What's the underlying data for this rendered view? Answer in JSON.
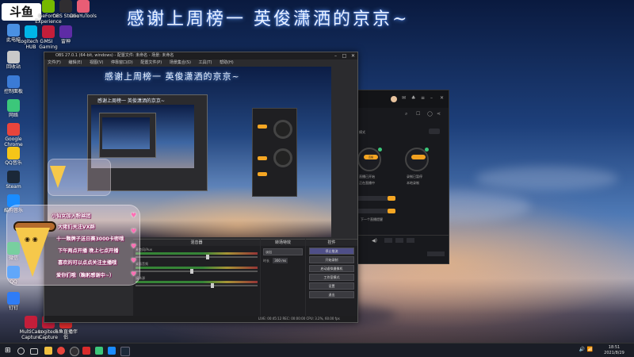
{
  "banner": {
    "text": "感谢上周榜一 英俊潇洒的京京~"
  },
  "logo": {
    "text": "斗鱼"
  },
  "desktop_icons": [
    {
      "label": "此电脑",
      "color": "#4a90e2"
    },
    {
      "label": "回收站",
      "color": "#c9c9c9"
    },
    {
      "label": "控制面板",
      "color": "#3b7bd6"
    },
    {
      "label": "网络",
      "color": "#3bc77a"
    },
    {
      "label": "Google Chrome",
      "color": "#e8453c"
    },
    {
      "label": "QQ音乐",
      "color": "#f5c518"
    },
    {
      "label": "Steam",
      "color": "#1b2838"
    },
    {
      "label": "酷狗音乐",
      "color": "#1a8cff"
    },
    {
      "label": "微信",
      "color": "#3bc77a"
    },
    {
      "label": "QQ",
      "color": "#1a8cff"
    },
    {
      "label": "钉钉",
      "color": "#2f7cf6"
    },
    {
      "label": "GeForce Experience",
      "color": "#76b900"
    },
    {
      "label": "Logitech G HUB",
      "color": "#00b4e6"
    },
    {
      "label": "MSI Gaming APP",
      "color": "#c41e3a"
    },
    {
      "label": "OBS Studio",
      "color": "#302e31"
    },
    {
      "label": "雷神",
      "color": "#5e2ca5"
    },
    {
      "label": "DouYuTools",
      "color": "#e85d75"
    },
    {
      "label": "MultiCam Capture Lite",
      "color": "#c41e3a"
    },
    {
      "label": "Logitech Capture",
      "color": "#c41e3a"
    },
    {
      "label": "斗鱼直播伴侣",
      "color": "#d92b2b"
    }
  ],
  "obs": {
    "title": "OBS 27.0.1 (64-bit, windows) - 配置文件: 未命名 - 场景: 未命名",
    "menu": [
      "文件(F)",
      "编辑(E)",
      "视图(V)",
      "停靠窗口(D)",
      "配置文件(P)",
      "场景集合(S)",
      "工具(T)",
      "帮助(H)"
    ],
    "preview_banner": "感谢上周榜一 英俊潇洒的京京~",
    "nested_banner": "感谢上周榜一 英俊潇洒的京京~",
    "docks": {
      "mixer_title": "混音器",
      "transition_title": "转场特效",
      "controls_title": "控件"
    },
    "mixer": [
      {
        "name": "麦克风/Aux",
        "level": 0.58
      },
      {
        "name": "桌面音频",
        "level": 0.45
      },
      {
        "name": "媒体源",
        "level": 0.62
      }
    ],
    "transition": {
      "type": "淡出",
      "duration_label": "时长",
      "duration": "300 ms"
    },
    "controls": [
      {
        "label": "停止推流",
        "active": true
      },
      {
        "label": "开始录制",
        "active": false
      },
      {
        "label": "启动虚拟摄像机",
        "active": false
      },
      {
        "label": "工作室模式",
        "active": false
      },
      {
        "label": "设置",
        "active": false
      },
      {
        "label": "退出",
        "active": false
      }
    ],
    "status": "LIVE: 00:45:12  REC: 00:00:00  CPU: 3.2%, 60.00 fps"
  },
  "right_app": {
    "left_circle_label": "直播已开始",
    "right_circle_label": "录制已暂停",
    "left_sub": "正在直播中",
    "right_sub": "本地录制",
    "mode_label": "模式",
    "hint": "下一个直播提醒",
    "chip": "直播"
  },
  "chat": [
    "小仙女加入粉丝团",
    "大佬们关注VX群",
    "十一颗牌子送日赛3000卡密哦",
    "下午两点开播 晚上七点开播",
    "喜欢的可以点点关注主播哦",
    "爱你们哦（鞠躬感谢中~）"
  ],
  "taskbar": {
    "time": "18:51",
    "date": "2021/8/29",
    "apps": [
      "开始",
      "搜索",
      "任务视图",
      "文件资源管理器",
      "Chrome",
      "OBS",
      "斗鱼",
      "微信",
      "QQ",
      "Steam"
    ]
  }
}
